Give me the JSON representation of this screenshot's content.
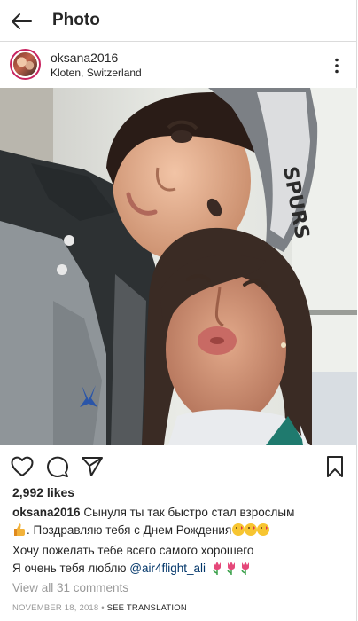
{
  "topbar": {
    "title": "Photo",
    "back_icon": "arrow-left-icon"
  },
  "post": {
    "username": "oksana2016",
    "location": "Kloten, Switzerland",
    "more_icon": "more-vertical-icon",
    "photo_icon": "selfie-photo",
    "likes_text": "2,992 likes",
    "caption": {
      "user": "oksana2016",
      "line1": "Сынуля ты так быстро стал взрослым",
      "line2": ". Поздравляю тебя с Днем Рождения",
      "line3": "Хочу пожелать тебе всего самого хорошего",
      "line4": "Я очень тебя люблю ",
      "mention": "@air4flight_ali"
    },
    "view_comments": "View all 31 comments",
    "date": "NOVEMBER 18, 2018",
    "separator": " • ",
    "see_translation": "SEE TRANSLATION"
  },
  "colors": {
    "text": "#262626",
    "muted": "#999999",
    "mention": "#003569",
    "divider": "#dbdbdb",
    "story_ring": "#c8235f"
  }
}
